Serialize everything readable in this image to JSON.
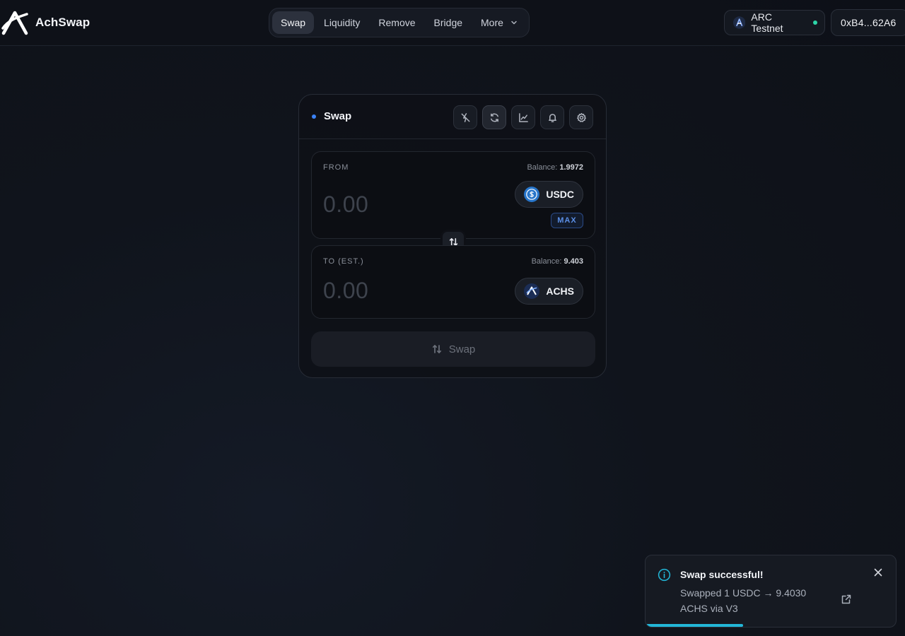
{
  "app": {
    "name": "AchSwap",
    "logo_icon": "achswap-logo-icon"
  },
  "nav": {
    "items": [
      {
        "label": "Swap",
        "active": true
      },
      {
        "label": "Liquidity",
        "active": false
      },
      {
        "label": "Remove",
        "active": false
      },
      {
        "label": "Bridge",
        "active": false
      },
      {
        "label": "More",
        "active": false,
        "icon": "chevron-down-icon"
      }
    ]
  },
  "network": {
    "label": "ARC Testnet",
    "icon": "arc-network-icon",
    "status_color": "#2dd4a8"
  },
  "wallet": {
    "address": "0xB4...62A6"
  },
  "swap_card": {
    "title": "Swap",
    "title_dot_color": "#3b82f6",
    "tools": [
      {
        "icon": "routing-off-icon",
        "active": false
      },
      {
        "icon": "refresh-icon",
        "active": true
      },
      {
        "icon": "chart-icon",
        "active": false
      },
      {
        "icon": "bell-icon",
        "active": false
      },
      {
        "icon": "settings-gear-icon",
        "active": false
      }
    ],
    "from": {
      "label": "FROM",
      "balance_label": "Balance:",
      "balance_value": "1.9972",
      "amount_placeholder": "0.00",
      "token": "USDC",
      "token_icon": "usdc-token-icon",
      "max_label": "MAX"
    },
    "flip_icon": "swap-arrows-icon",
    "to": {
      "label": "TO (EST.)",
      "balance_label": "Balance:",
      "balance_value": "9.403",
      "amount_placeholder": "0.00",
      "token": "ACHS",
      "token_icon": "achs-token-icon"
    },
    "submit_label": "Swap",
    "submit_enabled": false
  },
  "toast": {
    "title": "Swap successful!",
    "message": "Swapped 1 USDC → 9.4030 ACHS via V3",
    "icon": "info-icon",
    "progress_fraction": 0.385,
    "accent_color": "#22b7d8"
  }
}
